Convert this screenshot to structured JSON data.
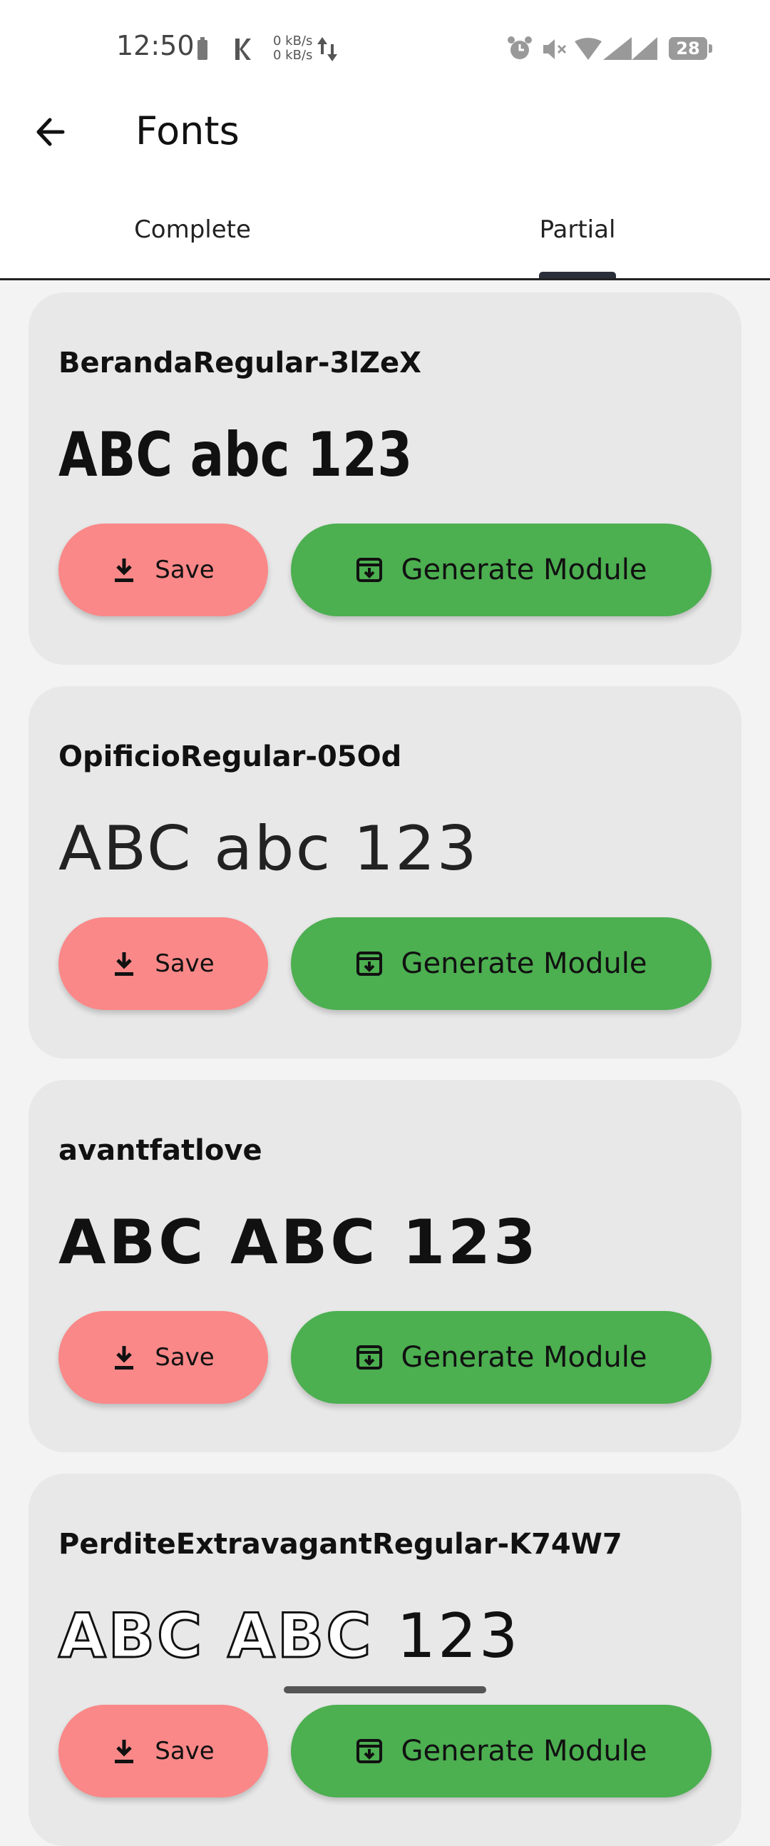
{
  "status_bar": {
    "time": "12:50",
    "net_up": "0 kB/s",
    "net_down": "0 kB/s",
    "battery": "28"
  },
  "app_bar": {
    "title": "Fonts",
    "back_icon": "arrow-left-icon"
  },
  "tabs": [
    {
      "label": "Complete",
      "selected": false
    },
    {
      "label": "Partial",
      "selected": true
    }
  ],
  "fonts": [
    {
      "name": "BerandaRegular-3lZeX",
      "sample": "ABC abc 123",
      "save_label": "Save",
      "generate_label": "Generate Module"
    },
    {
      "name": "OpificioRegular-05Od",
      "sample": "ABC abc 123",
      "save_label": "Save",
      "generate_label": "Generate Module"
    },
    {
      "name": "avantfatlove",
      "sample": "ABC ABC 123",
      "save_label": "Save",
      "generate_label": "Generate Module"
    },
    {
      "name": "PerditeExtravagantRegular-K74W7",
      "sample_letters": "ABC ABC",
      "sample_numbers": "123",
      "save_label": "Save",
      "generate_label": "Generate Module"
    }
  ],
  "colors": {
    "save_button": "#fa8888",
    "generate_button": "#4caf50",
    "card_background": "#e8e8e8"
  }
}
